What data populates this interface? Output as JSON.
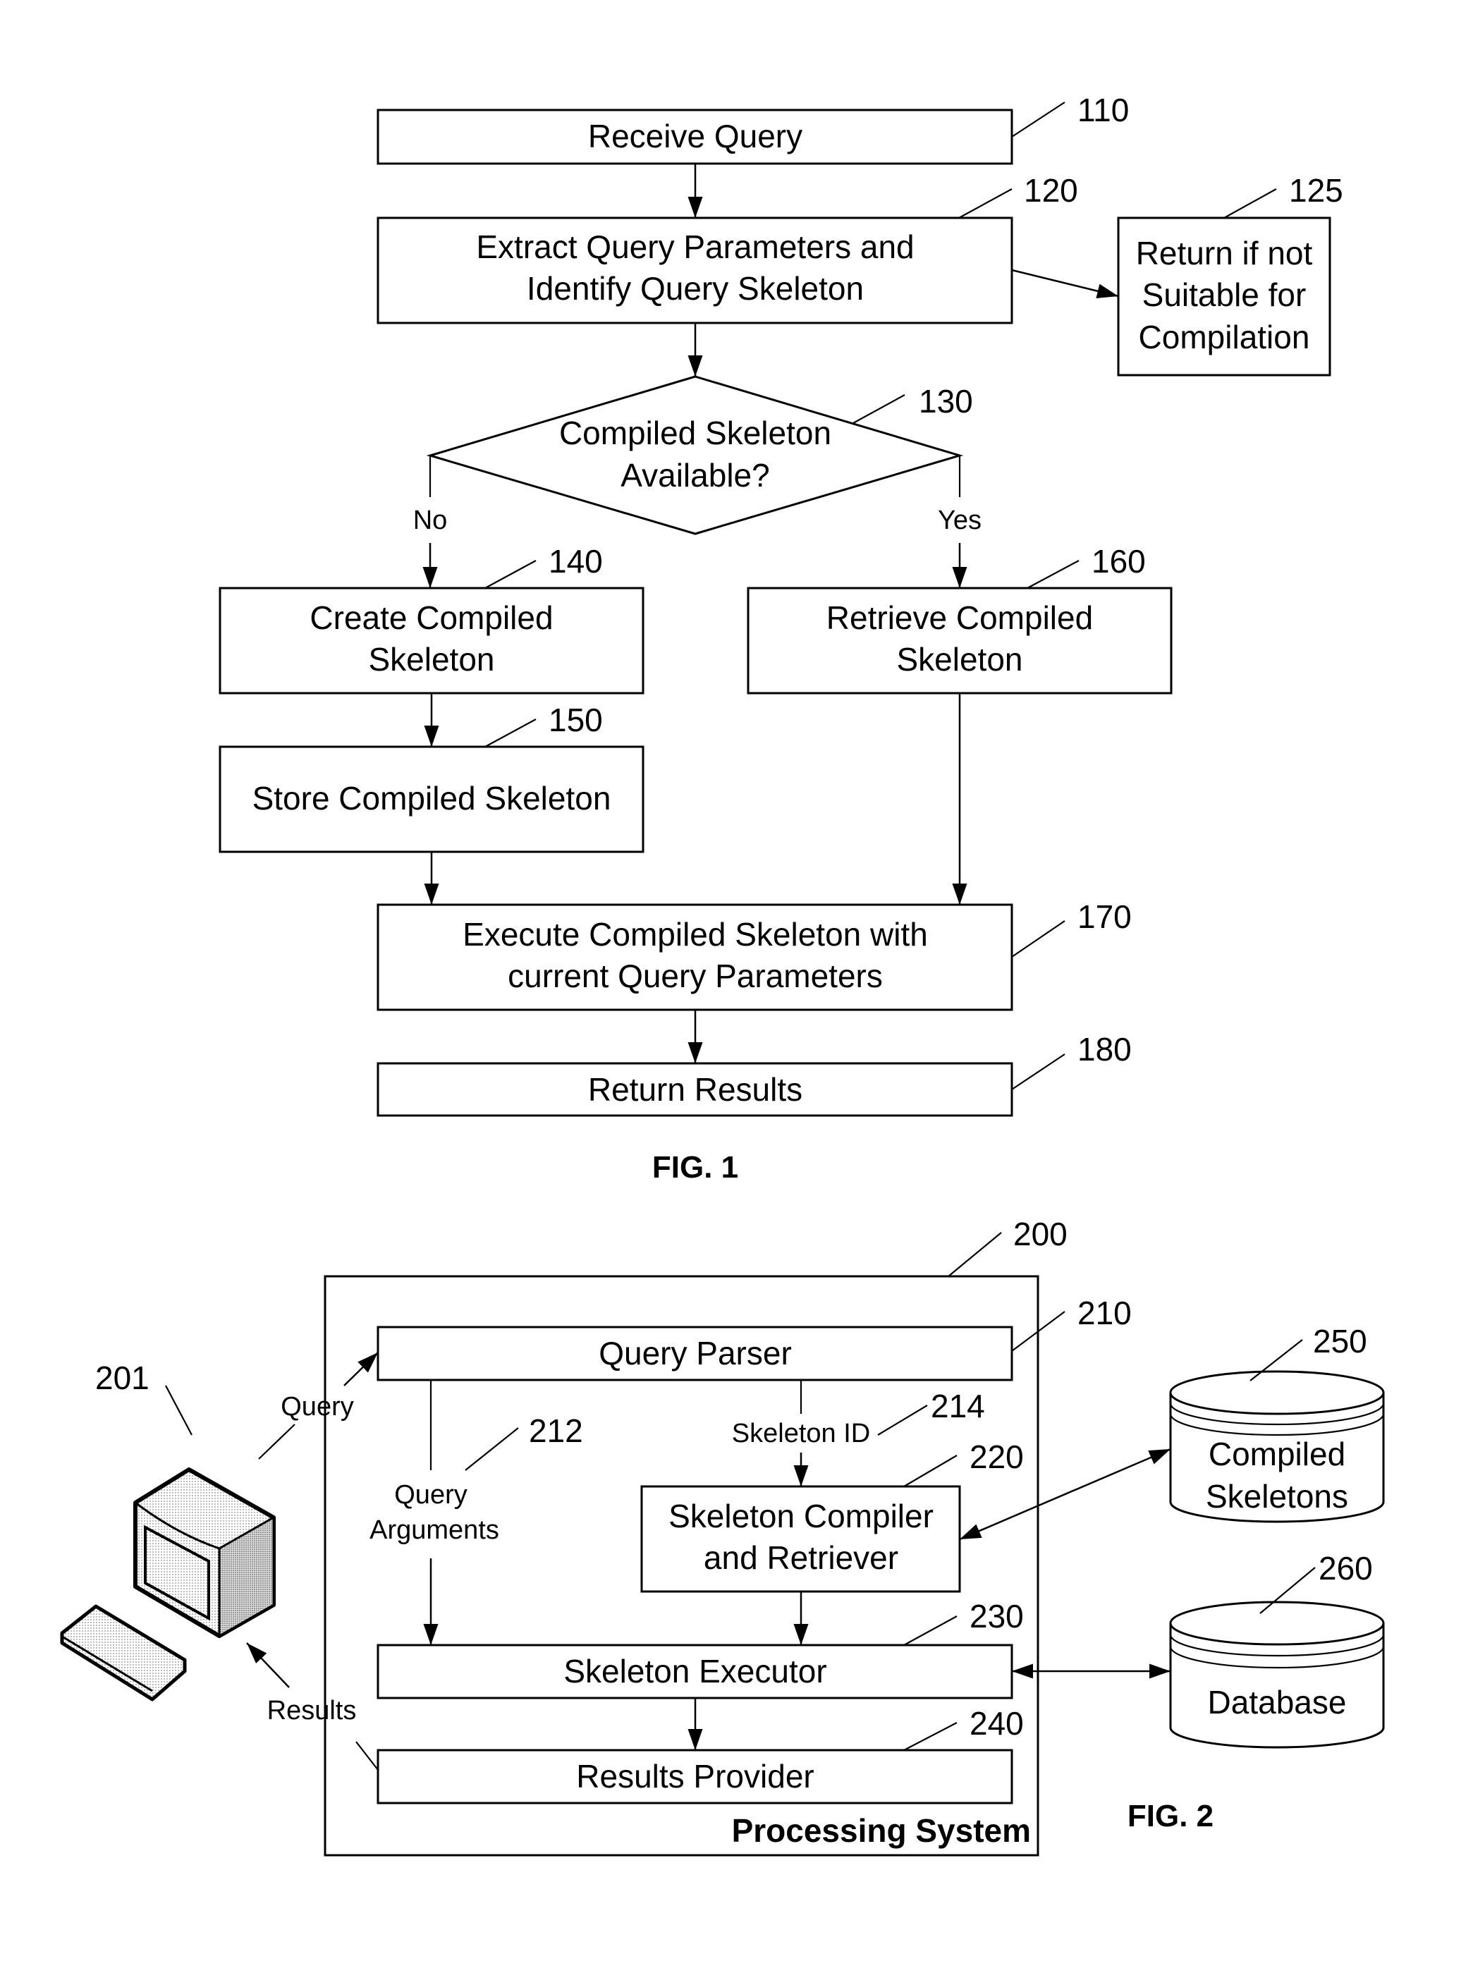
{
  "fig1": {
    "caption": "FIG. 1",
    "steps": {
      "s110": {
        "ref": "110",
        "lines": [
          "Receive Query"
        ]
      },
      "s120": {
        "ref": "120",
        "lines": [
          "Extract Query Parameters and",
          "Identify  Query Skeleton"
        ]
      },
      "s125": {
        "ref": "125",
        "lines": [
          "Return if not",
          "Suitable for",
          "Compilation"
        ]
      },
      "s130": {
        "ref": "130",
        "lines": [
          "Compiled Skeleton",
          "Available?"
        ]
      },
      "s140": {
        "ref": "140",
        "lines": [
          "Create Compiled",
          "Skeleton"
        ]
      },
      "s150": {
        "ref": "150",
        "lines": [
          "Store Compiled Skeleton"
        ]
      },
      "s160": {
        "ref": "160",
        "lines": [
          "Retrieve Compiled",
          "Skeleton"
        ]
      },
      "s170": {
        "ref": "170",
        "lines": [
          "Execute Compiled Skeleton with",
          "current Query Parameters"
        ]
      },
      "s180": {
        "ref": "180",
        "lines": [
          "Return Results"
        ]
      }
    },
    "branch_no": "No",
    "branch_yes": "Yes"
  },
  "fig2": {
    "caption": "FIG. 2",
    "system": {
      "ref": "200",
      "label": "Processing System"
    },
    "client": {
      "ref": "201"
    },
    "query_parser": {
      "ref": "210",
      "label": "Query Parser"
    },
    "query_arguments": {
      "ref": "212",
      "lines": [
        "Query",
        "Arguments"
      ]
    },
    "skeleton_id": {
      "ref": "214",
      "label": "Skeleton ID"
    },
    "compiler": {
      "ref": "220",
      "lines": [
        "Skeleton Compiler",
        "and Retriever"
      ]
    },
    "executor": {
      "ref": "230",
      "label": "Skeleton Executor"
    },
    "results_provider": {
      "ref": "240",
      "label": "Results Provider"
    },
    "compiled_skeletons": {
      "ref": "250",
      "lines": [
        "Compiled",
        "Skeletons"
      ]
    },
    "database": {
      "ref": "260",
      "label": "Database"
    },
    "query_flow_label": "Query",
    "results_flow_label": "Results"
  }
}
